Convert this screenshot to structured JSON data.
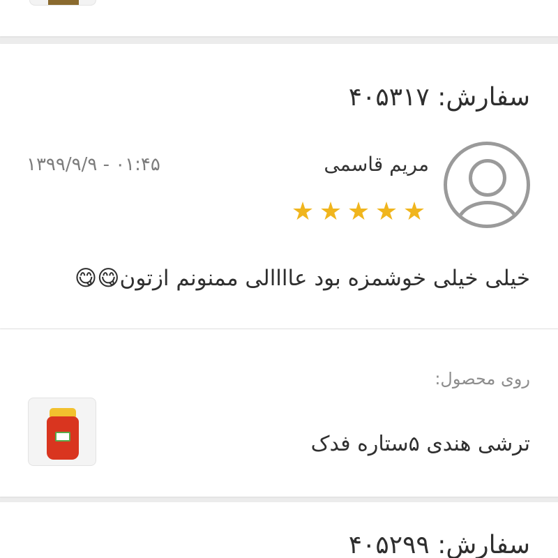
{
  "previous_card": {
    "thumbnail_icon": "product-jar-thumbnail"
  },
  "review": {
    "order_title": "سفارش: ۴۰۵۳۱۷",
    "reviewer_name": "مریم قاسمی",
    "avatar_icon": "user-avatar-icon",
    "date": "۱۳۹۹/۹/۹ - ۰۱:۴۵",
    "rating": 5,
    "rating_max": 5,
    "star_color": "#f0b51d",
    "stars": [
      "★",
      "★",
      "★",
      "★",
      "★"
    ],
    "comment": "خیلی خیلی خوشمزه بود عاااالی ممنونم ازتون😋😋"
  },
  "product": {
    "label": "روی محصول:",
    "name": "ترشی هندی ۵ستاره فدک",
    "thumbnail_icon": "pickle-jar-thumbnail"
  },
  "next_card": {
    "order_title": "سفارش: ۴۰۵۲۹۹"
  }
}
